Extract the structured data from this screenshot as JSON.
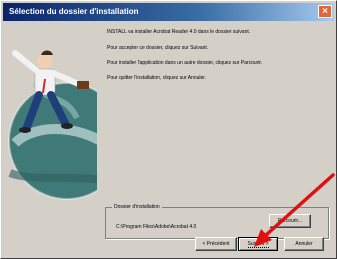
{
  "window": {
    "title": "Sélection du dossier d'installation"
  },
  "content": {
    "paragraph1": "INSTALL va installer Acrobat Reader 4.0 dans le dossier suivant.",
    "paragraph2": "Pour accepter ce dossier, cliquez sur Suivant.",
    "paragraph3": "Pour installer l'application dans un autre dossier, cliquez sur Parcourir.",
    "paragraph4": "Pour quitter l'installation, cliquez sur Annuler."
  },
  "destination": {
    "label": "Dossier d'installation",
    "path": "C:\\Program Files\\Adobe\\Acrobat 4.0"
  },
  "buttons": {
    "browse": "Parcourir...",
    "back": "< Précédent",
    "next": "Suivant >",
    "cancel": "Annuler",
    "close": "×"
  },
  "colors": {
    "titlebar": "#0a246a",
    "annotation_arrow": "#e01010",
    "close": "#e0663c"
  }
}
